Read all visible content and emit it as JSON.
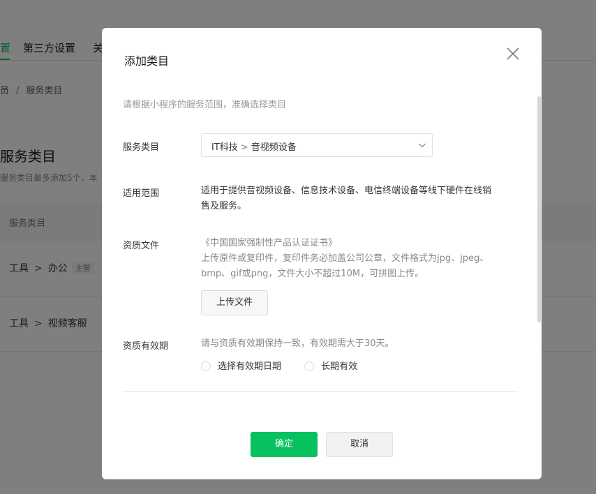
{
  "background": {
    "tabs": [
      "置",
      "第三方设置",
      "关"
    ],
    "breadcrumb": {
      "parent": "员",
      "separator": "/",
      "current": "服务类目"
    },
    "section_title": "服务类目",
    "section_desc": "服务类目最多添加5个，本",
    "table": {
      "header": "服务类目",
      "rows": [
        {
          "path": [
            "工具",
            "办公"
          ],
          "badge": "主营"
        },
        {
          "path": [
            "工具",
            "视频客服"
          ],
          "badge": ""
        }
      ],
      "arrow": ">"
    }
  },
  "dialog": {
    "title": "添加类目",
    "intro": "请根据小程序的服务范围，准确选择类目",
    "fields": {
      "category": {
        "label": "服务类目",
        "value_parent": "IT科技",
        "separator": ">",
        "value_child": "音视频设备"
      },
      "scope": {
        "label": "适用范围",
        "line1": "适用于提供音视频设备、信息技术设备、电信终端设备等线下硬件在线销",
        "line2": "售及服务。"
      },
      "qualification": {
        "label": "资质文件",
        "doc_name": "《中国国家强制性产品认证证书》",
        "desc1": "上传原件或复印件，复印件务必加盖公司公章，文件格式为jpg、jpeg、",
        "desc2": "bmp、gif或png，文件大小不超过10M，可拼图上传。",
        "upload_button": "上传文件"
      },
      "validity": {
        "label": "资质有效期",
        "hint": "请与资质有效期保持一致，有效期需大于30天。",
        "options": [
          "选择有效期日期",
          "长期有效"
        ]
      }
    },
    "buttons": {
      "confirm": "确定",
      "cancel": "取消"
    }
  },
  "colors": {
    "accent": "#07c160",
    "overlay": "rgba(0,0,0,0.5)"
  },
  "icons": {
    "close": "close-icon",
    "dropdown": "chevron-down-icon"
  }
}
